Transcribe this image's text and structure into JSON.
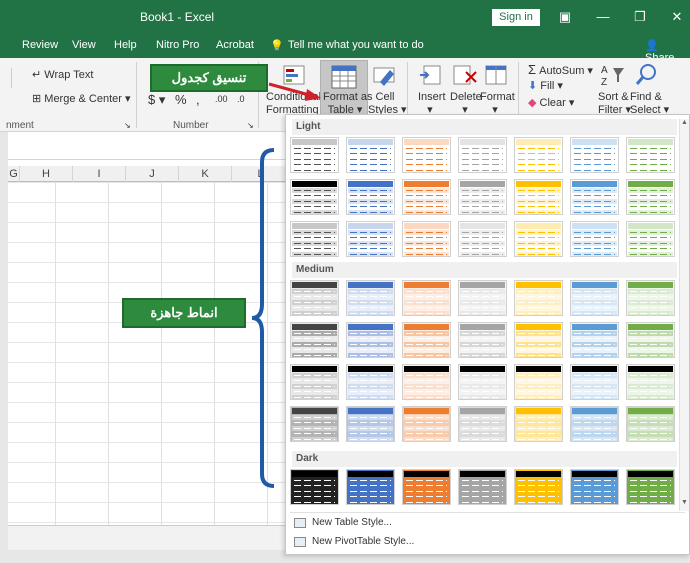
{
  "window": {
    "title": "Book1  -  Excel",
    "signin": "Sign in"
  },
  "tabs": [
    "Review",
    "View",
    "Help",
    "Nitro Pro",
    "Acrobat"
  ],
  "tell_me": "Tell me what you want to do",
  "share": "Share",
  "ribbon": {
    "wrap_text": "Wrap Text",
    "merge_center": "Merge & Center",
    "alignment_group": "nment",
    "number_group": "Number",
    "currency": "$",
    "percent": "%",
    "comma": ",",
    "dec_inc": ".00",
    "dec_dec": ".0",
    "conditional_line1": "Conditional",
    "conditional_line2": "Formatting",
    "format_table_line1": "Format as",
    "format_table_line2": "Table",
    "cell_styles_line1": "Cell",
    "cell_styles_line2": "Styles",
    "insert": "Insert",
    "delete": "Delete",
    "format": "Format",
    "autosum": "AutoSum",
    "fill": "Fill",
    "clear": "Clear",
    "sort_line1": "Sort &",
    "sort_line2": "Filter",
    "find_line1": "Find &",
    "find_line2": "Select"
  },
  "columns": [
    "G",
    "H",
    "I",
    "J",
    "K",
    "L"
  ],
  "gallery": {
    "light": "Light",
    "medium": "Medium",
    "dark": "Dark",
    "new_table_style": "New Table Style...",
    "new_pivot_style": "New PivotTable Style..."
  },
  "annotations": {
    "format_as_table_ar": "تنسيق كجدول",
    "ready_styles_ar": "انماط جاهزة"
  },
  "colors": {
    "excel_green": "#217346",
    "callout_green": "#2e8b3e",
    "style_colors": [
      "#444444",
      "#4472c4",
      "#ed7d31",
      "#a5a5a5",
      "#ffc000",
      "#5b9bd5",
      "#70ad47"
    ]
  }
}
